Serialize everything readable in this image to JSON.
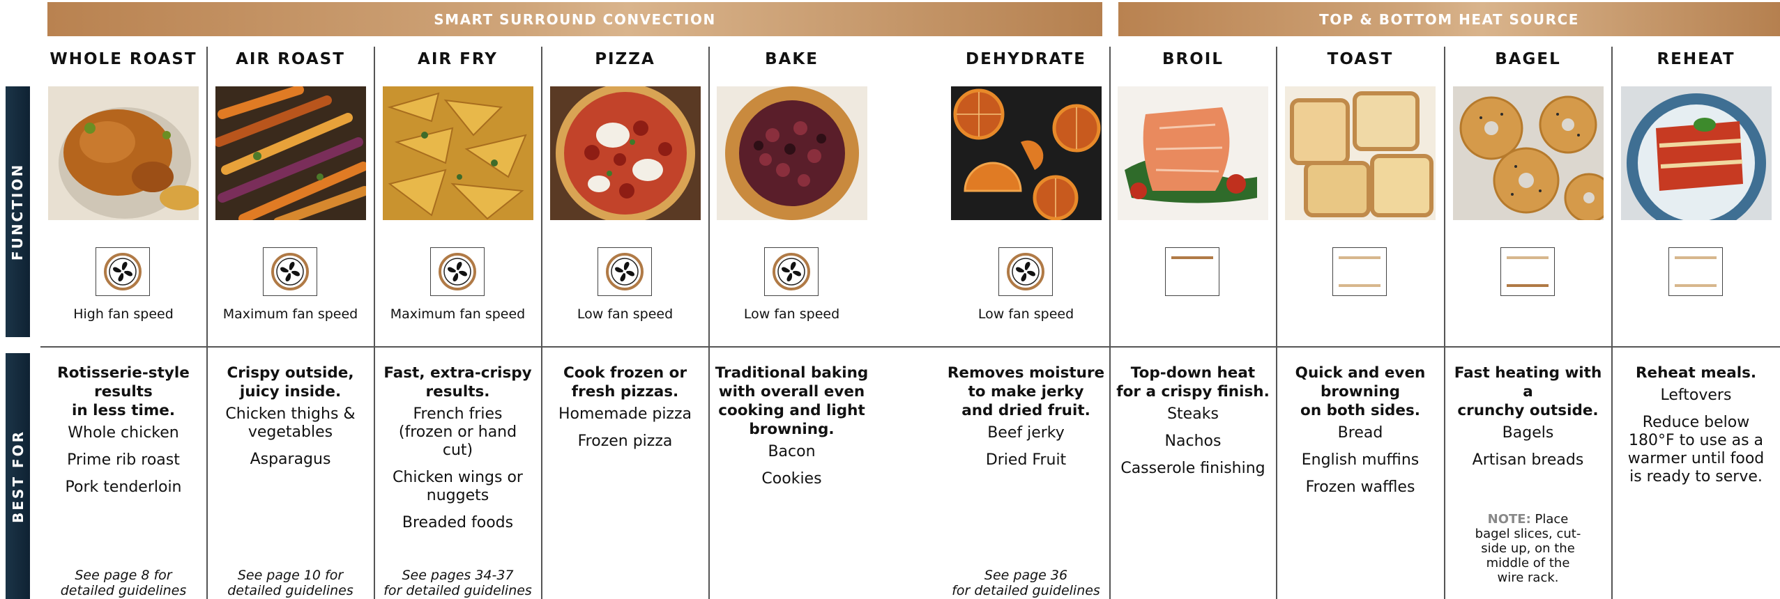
{
  "banners": {
    "convection": "SMART SURROUND CONVECTION",
    "top_bottom": "TOP & BOTTOM HEAT SOURCE"
  },
  "side_labels": {
    "function": "FUNCTION",
    "best_for": "BEST FOR"
  },
  "colors": {
    "bronze": "#b98250",
    "navy": "#14293a",
    "rule": "#555555"
  },
  "columns": [
    {
      "title": "WHOLE ROAST",
      "image": "roast-chicken",
      "icon": "fan-icon",
      "speed": "High fan speed",
      "headline": [
        "Rotisserie-style",
        "results",
        "in less time."
      ],
      "items": [
        "Whole chicken",
        "Prime rib roast",
        "Pork tenderloin"
      ],
      "guide": [
        "See page 8 for",
        "detailed guidelines"
      ]
    },
    {
      "title": "AIR ROAST",
      "image": "roasted-carrots",
      "icon": "fan-icon",
      "speed": "Maximum fan speed",
      "headline": [
        "Crispy outside,",
        "juicy inside."
      ],
      "items": [
        "Chicken thighs & vegetables",
        "Asparagus"
      ],
      "guide": [
        "See page 10 for",
        "detailed guidelines"
      ]
    },
    {
      "title": "AIR FRY",
      "image": "potato-wedges",
      "icon": "fan-icon",
      "speed": "Maximum fan speed",
      "headline": [
        "Fast, extra-crispy",
        "results."
      ],
      "items": [
        "French fries (frozen or hand cut)",
        "Chicken wings or nuggets",
        "Breaded foods"
      ],
      "guide": [
        "See pages 34-37",
        "for detailed guidelines"
      ]
    },
    {
      "title": "PIZZA",
      "image": "pepperoni-pizza",
      "icon": "fan-icon",
      "speed": "Low fan speed",
      "headline": [
        "Cook frozen or",
        "fresh pizzas."
      ],
      "items": [
        "Homemade pizza",
        "Frozen pizza"
      ],
      "guide": []
    },
    {
      "title": "BAKE",
      "image": "berry-galette",
      "icon": "fan-icon",
      "speed": "Low fan speed",
      "headline": [
        "Traditional baking",
        "with overall even",
        "cooking and light",
        "browning."
      ],
      "items": [
        "Bacon",
        "Cookies"
      ],
      "guide": []
    },
    {
      "title": "DEHYDRATE",
      "image": "dried-oranges",
      "icon": "fan-icon",
      "speed": "Low fan speed",
      "headline": [
        "Removes moisture",
        "to make jerky",
        "and dried fruit."
      ],
      "items": [
        "Beef jerky",
        "Dried Fruit"
      ],
      "guide": [
        "See page 36",
        "for detailed guidelines"
      ]
    },
    {
      "title": "BROIL",
      "image": "salmon-fillet",
      "icon": "top-heat-icon",
      "speed": "",
      "headline": [
        "Top-down heat",
        "for a crispy finish."
      ],
      "items": [
        "Steaks",
        "Nachos",
        "Casserole finishing"
      ],
      "guide": []
    },
    {
      "title": "TOAST",
      "image": "toast-slices",
      "icon": "top-bottom-heat-icon",
      "speed": "",
      "headline": [
        "Quick and even",
        "browning",
        "on both sides."
      ],
      "items": [
        "Bread",
        "English muffins",
        "Frozen waffles"
      ],
      "guide": []
    },
    {
      "title": "BAGEL",
      "image": "bagels",
      "icon": "bottom-heat-icon",
      "speed": "",
      "headline": [
        "Fast heating with a",
        "crunchy outside."
      ],
      "items": [
        "Bagels",
        "Artisan breads"
      ],
      "note": {
        "label": "NOTE:",
        "lines": [
          " Place",
          "bagel slices, cut-",
          "side up, on the",
          "middle of the",
          "wire rack."
        ]
      },
      "guide": []
    },
    {
      "title": "REHEAT",
      "image": "lasagna",
      "icon": "top-bottom-heat-icon",
      "speed": "",
      "headline": [
        "Reheat meals."
      ],
      "items": [
        "Leftovers",
        "Reduce below 180°F to use as a warmer until food is ready to serve."
      ],
      "guide": []
    }
  ]
}
